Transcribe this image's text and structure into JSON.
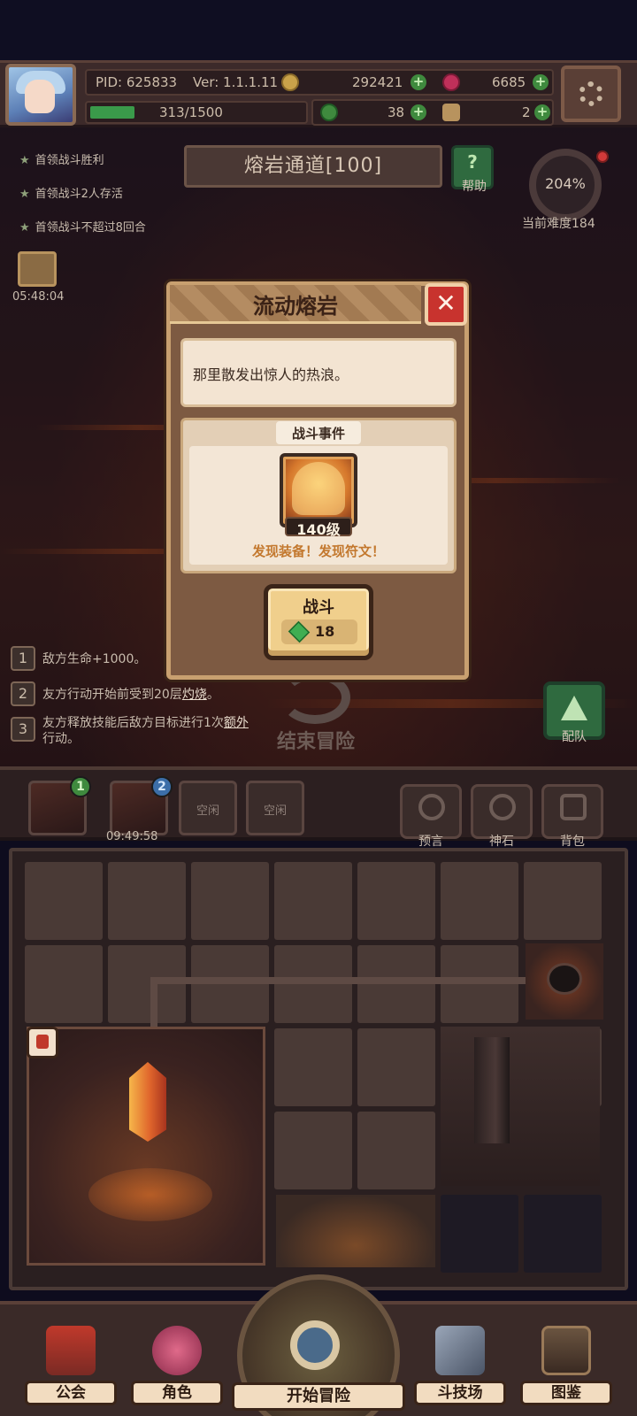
{
  "hud": {
    "pid": "PID: 625833",
    "version": "Ver: 1.1.1.11",
    "gold": "292421",
    "gems": "6685",
    "stamina": "313/1500",
    "stamina_fraction": 0.21,
    "clover": "38",
    "scroll": "2"
  },
  "quests": [
    "首领战斗胜利",
    "首领战斗2人存活",
    "首领战斗不超过8回合"
  ],
  "stage": {
    "title": "熔岩通道[100]",
    "help_label": "帮助",
    "difficulty_percent": "204%",
    "difficulty_label": "当前难度184"
  },
  "gift": {
    "timer": "05:48:04"
  },
  "modal": {
    "title": "流动熔岩",
    "description": "那里散发出惊人的热浪。",
    "event_title": "战斗事件",
    "boss_level": "140级",
    "rewards": "发现装备！发现符文！",
    "fight_label": "战斗",
    "fight_cost": "18"
  },
  "rules": [
    {
      "num": "1",
      "text": "敌方生命+1000。"
    },
    {
      "num": "2",
      "pre": "友方行动开始前受到20层",
      "hl": "灼烧",
      "post": "。"
    },
    {
      "num": "3",
      "pre": "友方释放技能后敌方目标进行1次",
      "hl": "额外",
      "line2": "行动。"
    }
  ],
  "actions": {
    "end_adventure": "结束冒险",
    "team": "配队"
  },
  "slots": {
    "slot1_badge": "1",
    "slot2_badge": "2",
    "slot2_timer": "09:49:58",
    "slot3_label": "空闲",
    "slot4_label": "空闲"
  },
  "tools": [
    "预言",
    "神石",
    "背包"
  ],
  "nav": {
    "guild": "公会",
    "character": "角色",
    "start": "开始冒险",
    "arena": "斗技场",
    "codex": "图鉴"
  }
}
